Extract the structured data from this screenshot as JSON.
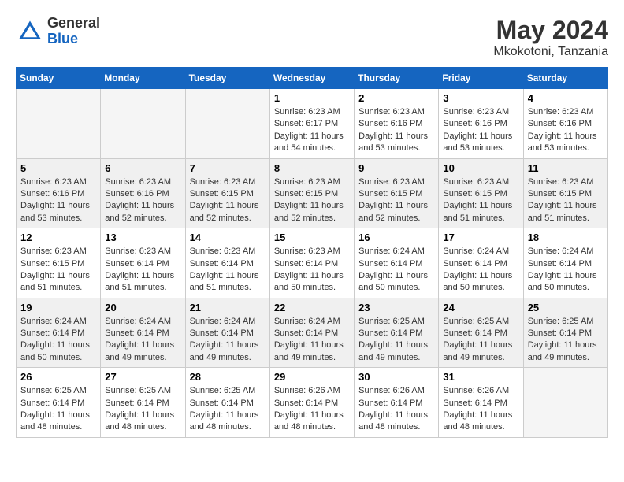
{
  "header": {
    "logo_general": "General",
    "logo_blue": "Blue",
    "month_year": "May 2024",
    "location": "Mkokotoni, Tanzania"
  },
  "days_of_week": [
    "Sunday",
    "Monday",
    "Tuesday",
    "Wednesday",
    "Thursday",
    "Friday",
    "Saturday"
  ],
  "weeks": [
    {
      "shaded": false,
      "days": [
        {
          "num": "",
          "text": ""
        },
        {
          "num": "",
          "text": ""
        },
        {
          "num": "",
          "text": ""
        },
        {
          "num": "1",
          "text": "Sunrise: 6:23 AM\nSunset: 6:17 PM\nDaylight: 11 hours\nand 54 minutes."
        },
        {
          "num": "2",
          "text": "Sunrise: 6:23 AM\nSunset: 6:16 PM\nDaylight: 11 hours\nand 53 minutes."
        },
        {
          "num": "3",
          "text": "Sunrise: 6:23 AM\nSunset: 6:16 PM\nDaylight: 11 hours\nand 53 minutes."
        },
        {
          "num": "4",
          "text": "Sunrise: 6:23 AM\nSunset: 6:16 PM\nDaylight: 11 hours\nand 53 minutes."
        }
      ]
    },
    {
      "shaded": true,
      "days": [
        {
          "num": "5",
          "text": "Sunrise: 6:23 AM\nSunset: 6:16 PM\nDaylight: 11 hours\nand 53 minutes."
        },
        {
          "num": "6",
          "text": "Sunrise: 6:23 AM\nSunset: 6:16 PM\nDaylight: 11 hours\nand 52 minutes."
        },
        {
          "num": "7",
          "text": "Sunrise: 6:23 AM\nSunset: 6:15 PM\nDaylight: 11 hours\nand 52 minutes."
        },
        {
          "num": "8",
          "text": "Sunrise: 6:23 AM\nSunset: 6:15 PM\nDaylight: 11 hours\nand 52 minutes."
        },
        {
          "num": "9",
          "text": "Sunrise: 6:23 AM\nSunset: 6:15 PM\nDaylight: 11 hours\nand 52 minutes."
        },
        {
          "num": "10",
          "text": "Sunrise: 6:23 AM\nSunset: 6:15 PM\nDaylight: 11 hours\nand 51 minutes."
        },
        {
          "num": "11",
          "text": "Sunrise: 6:23 AM\nSunset: 6:15 PM\nDaylight: 11 hours\nand 51 minutes."
        }
      ]
    },
    {
      "shaded": false,
      "days": [
        {
          "num": "12",
          "text": "Sunrise: 6:23 AM\nSunset: 6:15 PM\nDaylight: 11 hours\nand 51 minutes."
        },
        {
          "num": "13",
          "text": "Sunrise: 6:23 AM\nSunset: 6:14 PM\nDaylight: 11 hours\nand 51 minutes."
        },
        {
          "num": "14",
          "text": "Sunrise: 6:23 AM\nSunset: 6:14 PM\nDaylight: 11 hours\nand 51 minutes."
        },
        {
          "num": "15",
          "text": "Sunrise: 6:23 AM\nSunset: 6:14 PM\nDaylight: 11 hours\nand 50 minutes."
        },
        {
          "num": "16",
          "text": "Sunrise: 6:24 AM\nSunset: 6:14 PM\nDaylight: 11 hours\nand 50 minutes."
        },
        {
          "num": "17",
          "text": "Sunrise: 6:24 AM\nSunset: 6:14 PM\nDaylight: 11 hours\nand 50 minutes."
        },
        {
          "num": "18",
          "text": "Sunrise: 6:24 AM\nSunset: 6:14 PM\nDaylight: 11 hours\nand 50 minutes."
        }
      ]
    },
    {
      "shaded": true,
      "days": [
        {
          "num": "19",
          "text": "Sunrise: 6:24 AM\nSunset: 6:14 PM\nDaylight: 11 hours\nand 50 minutes."
        },
        {
          "num": "20",
          "text": "Sunrise: 6:24 AM\nSunset: 6:14 PM\nDaylight: 11 hours\nand 49 minutes."
        },
        {
          "num": "21",
          "text": "Sunrise: 6:24 AM\nSunset: 6:14 PM\nDaylight: 11 hours\nand 49 minutes."
        },
        {
          "num": "22",
          "text": "Sunrise: 6:24 AM\nSunset: 6:14 PM\nDaylight: 11 hours\nand 49 minutes."
        },
        {
          "num": "23",
          "text": "Sunrise: 6:25 AM\nSunset: 6:14 PM\nDaylight: 11 hours\nand 49 minutes."
        },
        {
          "num": "24",
          "text": "Sunrise: 6:25 AM\nSunset: 6:14 PM\nDaylight: 11 hours\nand 49 minutes."
        },
        {
          "num": "25",
          "text": "Sunrise: 6:25 AM\nSunset: 6:14 PM\nDaylight: 11 hours\nand 49 minutes."
        }
      ]
    },
    {
      "shaded": false,
      "days": [
        {
          "num": "26",
          "text": "Sunrise: 6:25 AM\nSunset: 6:14 PM\nDaylight: 11 hours\nand 48 minutes."
        },
        {
          "num": "27",
          "text": "Sunrise: 6:25 AM\nSunset: 6:14 PM\nDaylight: 11 hours\nand 48 minutes."
        },
        {
          "num": "28",
          "text": "Sunrise: 6:25 AM\nSunset: 6:14 PM\nDaylight: 11 hours\nand 48 minutes."
        },
        {
          "num": "29",
          "text": "Sunrise: 6:26 AM\nSunset: 6:14 PM\nDaylight: 11 hours\nand 48 minutes."
        },
        {
          "num": "30",
          "text": "Sunrise: 6:26 AM\nSunset: 6:14 PM\nDaylight: 11 hours\nand 48 minutes."
        },
        {
          "num": "31",
          "text": "Sunrise: 6:26 AM\nSunset: 6:14 PM\nDaylight: 11 hours\nand 48 minutes."
        },
        {
          "num": "",
          "text": ""
        }
      ]
    }
  ]
}
